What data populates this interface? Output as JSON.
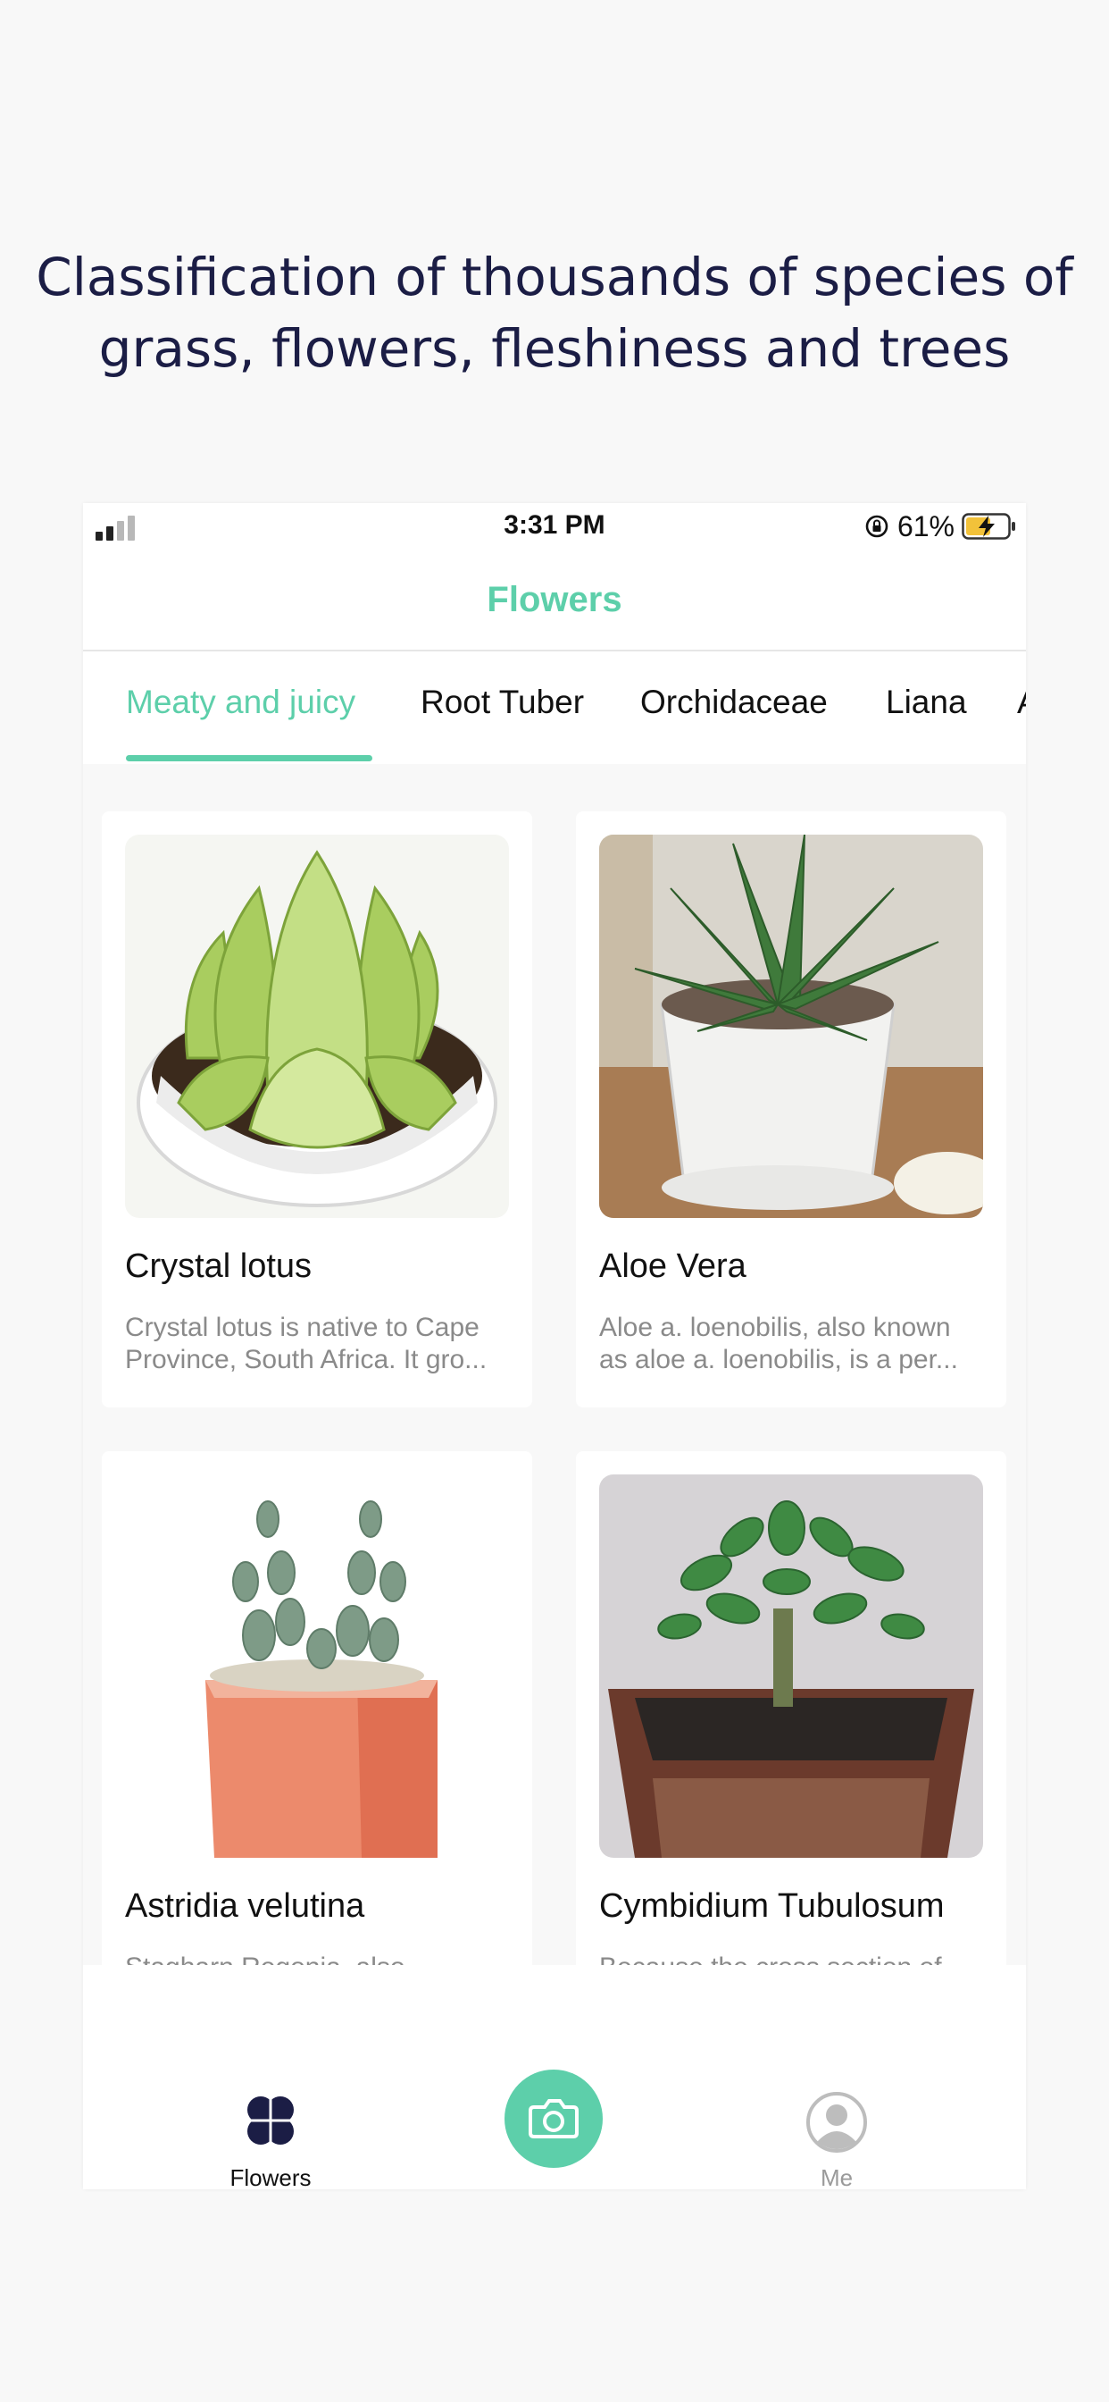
{
  "headline": {
    "line1": "Classification of thousands of species of",
    "line2": "grass, flowers, fleshiness and trees"
  },
  "status_bar": {
    "time": "3:31 PM",
    "battery": "61%",
    "battery_value": 0.61
  },
  "nav": {
    "title": "Flowers"
  },
  "tabs": [
    {
      "label": "Meaty and juicy",
      "active": true
    },
    {
      "label": "Root Tuber",
      "active": false
    },
    {
      "label": "Orchidaceae",
      "active": false
    },
    {
      "label": "Liana",
      "active": false
    },
    {
      "label": "A",
      "active": false
    }
  ],
  "cards": [
    {
      "name": "Crystal lotus",
      "desc": "Crystal lotus is native to Cape Province, South Africa. It gro..."
    },
    {
      "name": "Aloe Vera",
      "desc": "Aloe a. loenobilis, also known as aloe a. loenobilis, is a per..."
    },
    {
      "name": "Astridia velutina",
      "desc": "Stagharn Regonia, also known..."
    },
    {
      "name": "Cymbidium Tubulosum",
      "desc": "Because the cross section of..."
    }
  ],
  "tabbar": {
    "flowers_label": "Flowers",
    "me_label": "Me"
  },
  "colors": {
    "accent": "#5dcfaa",
    "headline": "#1b1d45",
    "active_tab_icon": "#1b1d45",
    "inactive_tab": "#bdbdbd"
  },
  "icons": {
    "signal": "cellular-signal-icon",
    "orientation_lock": "orientation-lock-icon",
    "battery": "battery-charging-icon",
    "flowers_tab": "four-leaf-clover-icon",
    "camera": "camera-icon",
    "me_tab": "user-avatar-icon"
  }
}
